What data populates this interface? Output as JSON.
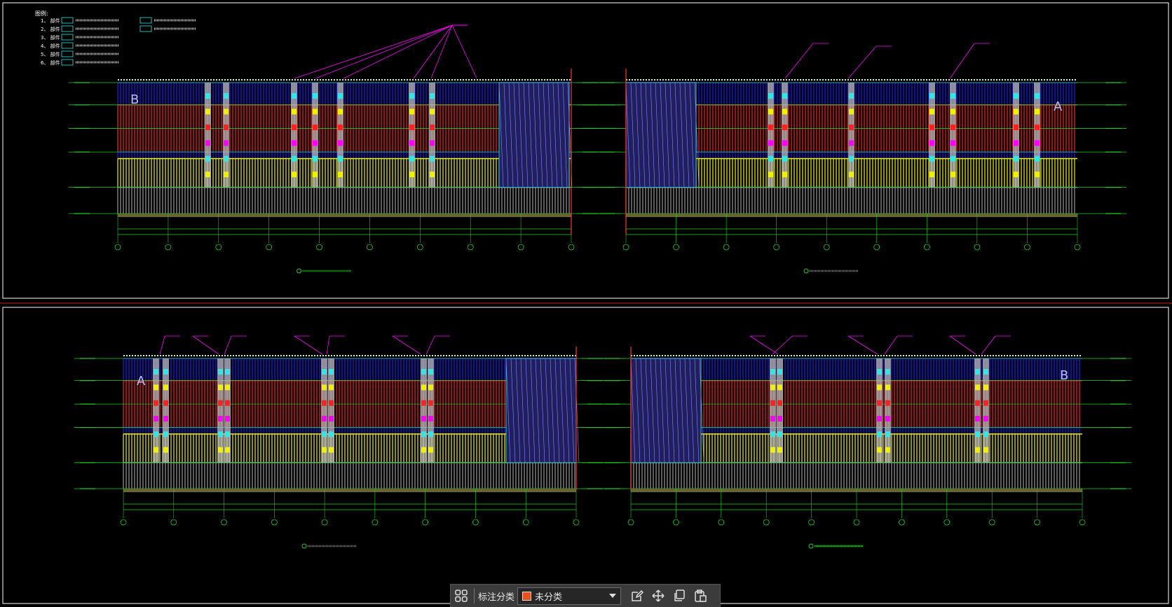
{
  "drawing": {
    "legend": {
      "heading": "图例:",
      "rows": [
        "1、 部件",
        "2、 部件",
        "3、 部件",
        "4、 部件",
        "5、 部件",
        "6、 部件"
      ]
    },
    "zones": {
      "left_label": "B",
      "right_label": "A",
      "bottom_left_label": "A",
      "bottom_right_label": "B"
    }
  },
  "toolbar": {
    "grid_icon": "grid-icon",
    "category_label": "标注分类",
    "select_value": "未分类",
    "select_color": "#e8501e",
    "tools": [
      "edit-icon",
      "move-icon",
      "copy-icon",
      "paste-icon"
    ]
  },
  "colors": {
    "background": "#000000",
    "frame": "#ffffff",
    "divider": "#cc2222",
    "green": "#19d219",
    "blue": "#1a1aff",
    "red": "#ff2020",
    "yellow": "#f0f000",
    "magenta": "#ff00ff",
    "cyan": "#30e6e6",
    "gray": "#9a9a9a"
  }
}
